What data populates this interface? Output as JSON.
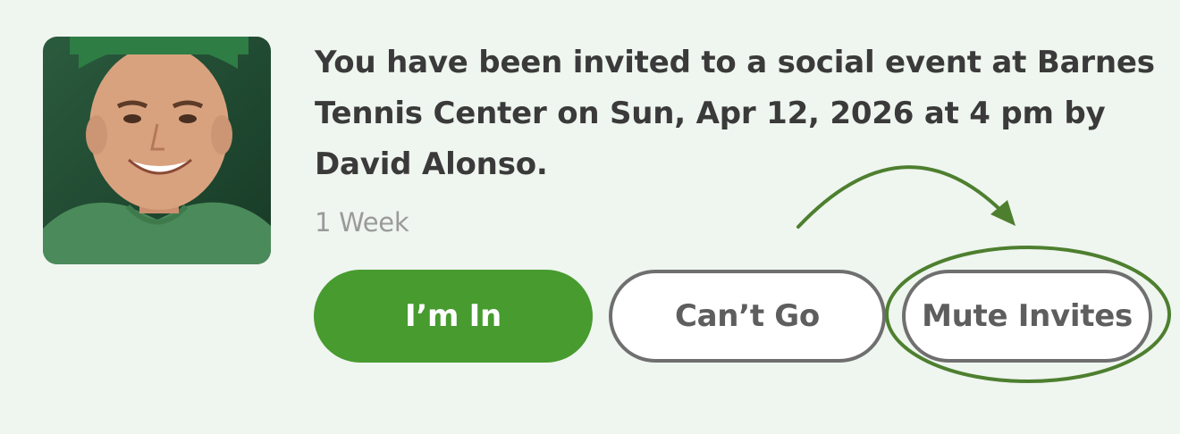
{
  "notification": {
    "message": "You have been invited to a social event at Barnes Tennis Center on Sun, Apr 12, 2026 at 4 pm by David Alonso.",
    "time_ago": "1 Week"
  },
  "actions": {
    "accept_label": "I’m In",
    "decline_label": "Can’t Go",
    "mute_label": "Mute Invites"
  },
  "colors": {
    "page_background": "#eff5ef",
    "accept_button": "#479b2f",
    "annotation": "#4d7f2f",
    "button_border": "#6f6f6f"
  }
}
